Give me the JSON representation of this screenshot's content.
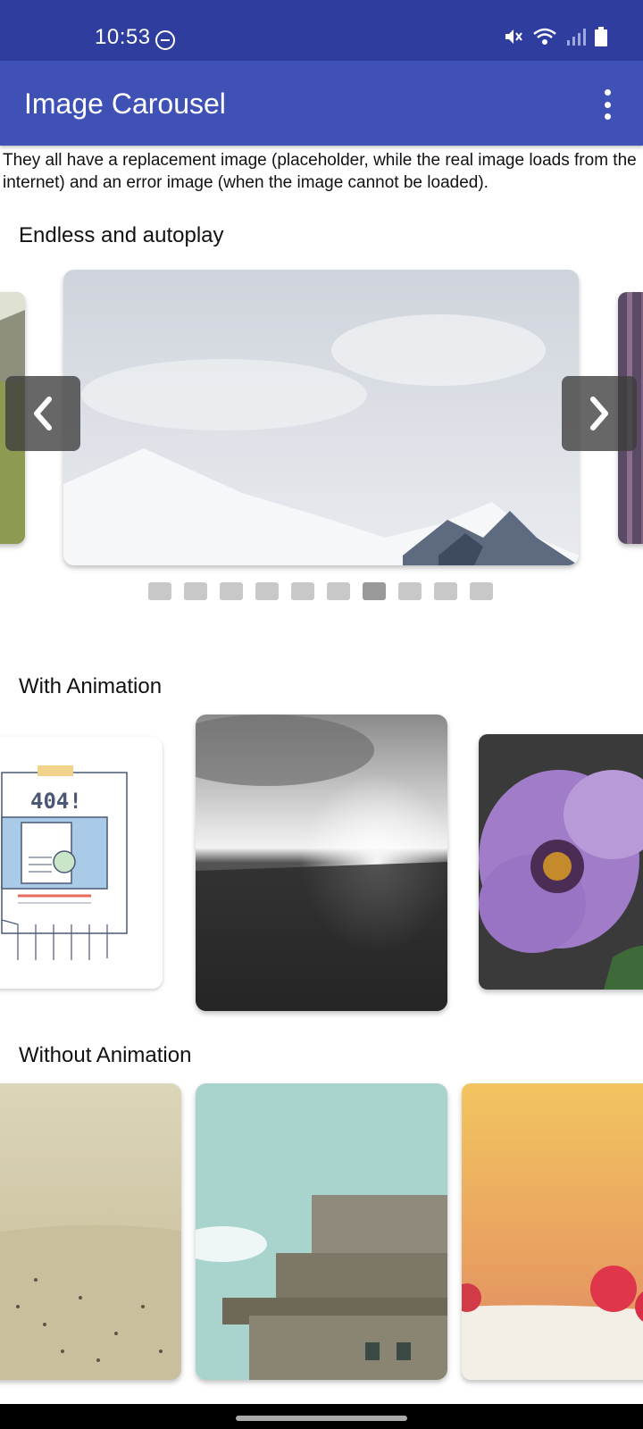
{
  "status": {
    "time": "10:53"
  },
  "appbar": {
    "title": "Image Carousel",
    "menu_icon": "more-vert-icon"
  },
  "intro": "They all have a replacement image (placeholder, while the real image loads from the internet) and an error image (when the image cannot be loaded).",
  "sections": {
    "endless": {
      "title": "Endless and autoplay",
      "indicator_count": 10,
      "active_index": 6
    },
    "animation": {
      "title": "With Animation",
      "error_image_text": "404!"
    },
    "no_animation": {
      "title": "Without Animation"
    }
  },
  "colors": {
    "status_bar": "#2f3e9e",
    "app_bar": "#3f51b5",
    "indicator": "#c8c8c8",
    "indicator_active": "#9a9a9a"
  }
}
